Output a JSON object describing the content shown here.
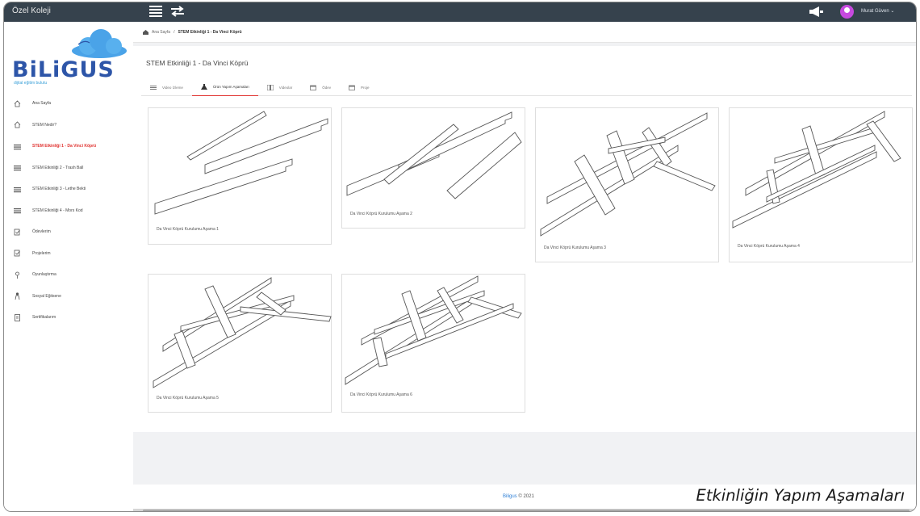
{
  "app": {
    "title": "Özel Koleji"
  },
  "user": {
    "name": "Murat Güven ⌄"
  },
  "logo": {
    "brand": "BiLiGUS",
    "tagline": "dijital eğitim bulutu"
  },
  "sidebar": {
    "items": [
      {
        "label": "Ana Sayfa",
        "icon": "home-icon",
        "active": false
      },
      {
        "label": "STEM Nedir?",
        "icon": "home-icon",
        "active": false
      },
      {
        "label": "STEM Etkinliği 1 - Da Vinci Köprü",
        "icon": "list-icon",
        "active": true
      },
      {
        "label": "STEM Etkinliği 2 - Trash Ball",
        "icon": "list-icon",
        "active": false
      },
      {
        "label": "STEM Etkinliği 3 - Lethe Bekti",
        "icon": "list-icon",
        "active": false
      },
      {
        "label": "STEM Etkinliği 4 - Mors Kod",
        "icon": "list-icon",
        "active": false
      },
      {
        "label": "Ödevlerim",
        "icon": "checklist-icon",
        "active": false
      },
      {
        "label": "Projelerim",
        "icon": "checklist-icon",
        "active": false
      },
      {
        "label": "Oyunlaştırma",
        "icon": "pin-icon",
        "active": false
      },
      {
        "label": "Sosyal Eğitsene",
        "icon": "person-icon",
        "active": false
      },
      {
        "label": "Sertifikalarım",
        "icon": "document-icon",
        "active": false
      }
    ]
  },
  "breadcrumb": {
    "home": "Ana Sayfa",
    "separator": "/",
    "current": "STEM Etkinliği 1 - Da Vinci Köprü"
  },
  "page": {
    "title": "STEM Etkinliği 1 - Da Vinci Köprü"
  },
  "tabs": [
    {
      "label": "Video İzleme",
      "icon": "list-icon",
      "active": false
    },
    {
      "label": "Ürün Yapım Aşamaları",
      "icon": "flask-icon",
      "active": true
    },
    {
      "label": "Videolar",
      "icon": "film-icon",
      "active": false
    },
    {
      "label": "Ödev",
      "icon": "calendar-icon",
      "active": false
    },
    {
      "label": "Proje",
      "icon": "calendar-icon",
      "active": false
    }
  ],
  "cards": [
    {
      "caption": "Da Vinci Köprü Kurulumu Aşama 1"
    },
    {
      "caption": "Da Vinci Köprü Kurulumu Aşama 2"
    },
    {
      "caption": "Da Vinci Köprü Kurulumu Aşama 3"
    },
    {
      "caption": "Da Vinci Köprü Kurulumu Aşama 4"
    },
    {
      "caption": "Da Vinci Köprü Kurulumu Aşama 5"
    },
    {
      "caption": "Da Vinci Köprü Kurulumu Aşama 6"
    }
  ],
  "footer": {
    "brand": "Biligus",
    "copyright": "© 2021"
  },
  "overlay": {
    "caption": "Etkinliğin Yapım Aşamaları"
  },
  "colors": {
    "topbar": "#36424d",
    "accent": "#e0322f",
    "brand": "#2d55a8",
    "avatar": "#c74adf"
  }
}
